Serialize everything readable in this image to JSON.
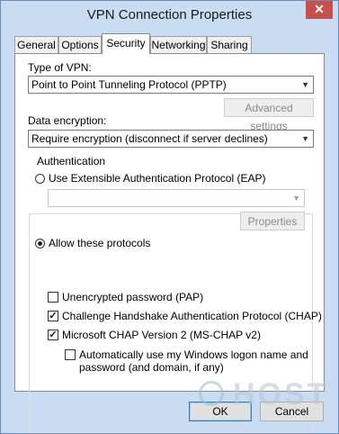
{
  "window": {
    "title": "VPN Connection Properties",
    "close_glyph": "✕"
  },
  "tabs": [
    {
      "label": "General"
    },
    {
      "label": "Options"
    },
    {
      "label": "Security"
    },
    {
      "label": "Networking"
    },
    {
      "label": "Sharing"
    }
  ],
  "security": {
    "vpn_type_label": "Type of VPN:",
    "vpn_type_value": "Point to Point Tunneling Protocol (PPTP)",
    "advanced_settings_label": "Advanced settings",
    "encryption_label": "Data encryption:",
    "encryption_value": "Require encryption (disconnect if server declines)",
    "auth_group_title": "Authentication",
    "eap_option_label": "Use Extensible Authentication Protocol (EAP)",
    "eap_select_value": "",
    "properties_label": "Properties",
    "allow_protocols_label": "Allow these protocols",
    "protocols": [
      {
        "label": "Unencrypted password (PAP)",
        "checked": false
      },
      {
        "label": "Challenge Handshake Authentication Protocol (CHAP)",
        "checked": true
      },
      {
        "label": "Microsoft CHAP Version 2 (MS-CHAP v2)",
        "checked": true
      }
    ],
    "auto_logon_line1": "Automatically use my Windows logon name and",
    "auto_logon_line2": "password (and domain, if any)",
    "auto_logon_checked": false
  },
  "footer": {
    "ok_label": "OK",
    "cancel_label": "Cancel"
  },
  "watermark": {
    "text": "HOST"
  },
  "colors": {
    "titlebar_bg": "#c9dcf1",
    "close_button": "#c7514a",
    "panel_bg": "#ffffff"
  }
}
